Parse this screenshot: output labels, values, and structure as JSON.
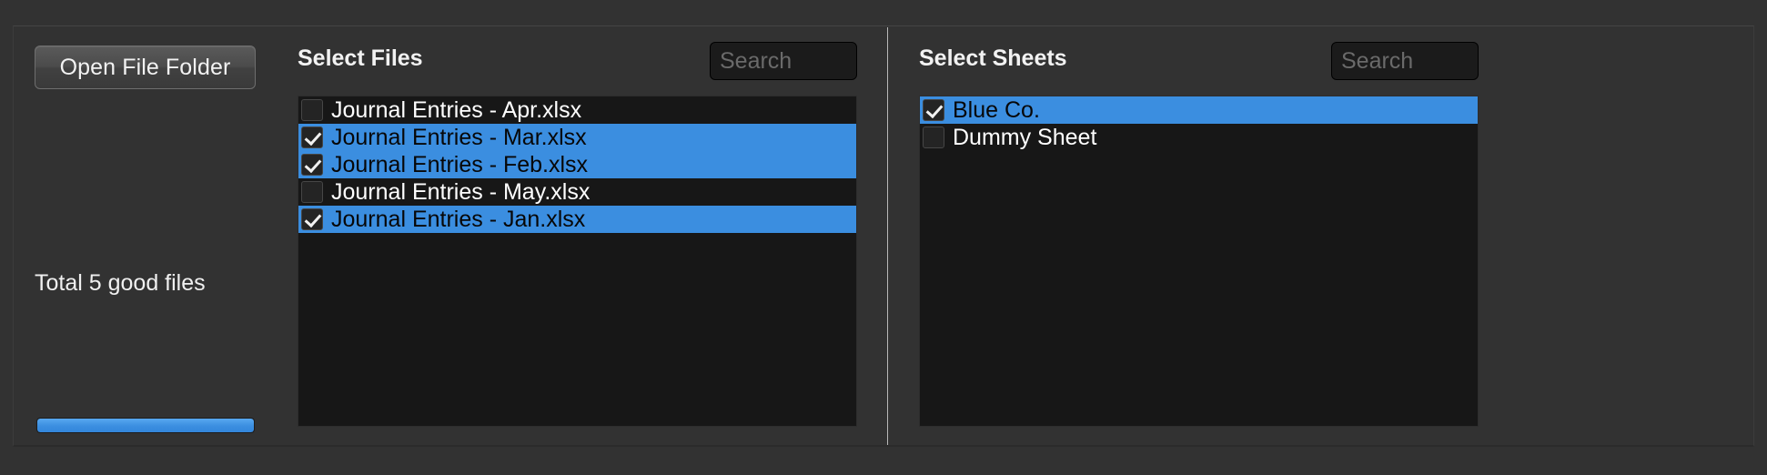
{
  "colors": {
    "window_background": "#323232",
    "panel_background": "#171717",
    "selection_blue": "#3b8ee0",
    "progress_blue": "#3b8ee0",
    "text_primary": "#f2f2f2",
    "text_on_selection": "#070707",
    "divider": "#b9b9b9"
  },
  "left_panel": {
    "open_folder_button_label": "Open File Folder",
    "total_files_label": "Total 5 good files",
    "progress": {
      "percent": 100
    }
  },
  "files_panel": {
    "title": "Select Files",
    "search": {
      "value": "",
      "placeholder": "Search"
    },
    "rows": [
      {
        "label": "Journal Entries - Apr.xlsx",
        "checked": false,
        "selected": false
      },
      {
        "label": "Journal Entries - Mar.xlsx",
        "checked": true,
        "selected": true
      },
      {
        "label": "Journal Entries - Feb.xlsx",
        "checked": true,
        "selected": true
      },
      {
        "label": "Journal Entries - May.xlsx",
        "checked": false,
        "selected": false
      },
      {
        "label": "Journal Entries - Jan.xlsx",
        "checked": true,
        "selected": true
      }
    ]
  },
  "sheets_panel": {
    "title": "Select Sheets",
    "search": {
      "value": "",
      "placeholder": "Search"
    },
    "rows": [
      {
        "label": "Blue Co.",
        "checked": true,
        "selected": true
      },
      {
        "label": "Dummy Sheet",
        "checked": false,
        "selected": false
      }
    ]
  }
}
